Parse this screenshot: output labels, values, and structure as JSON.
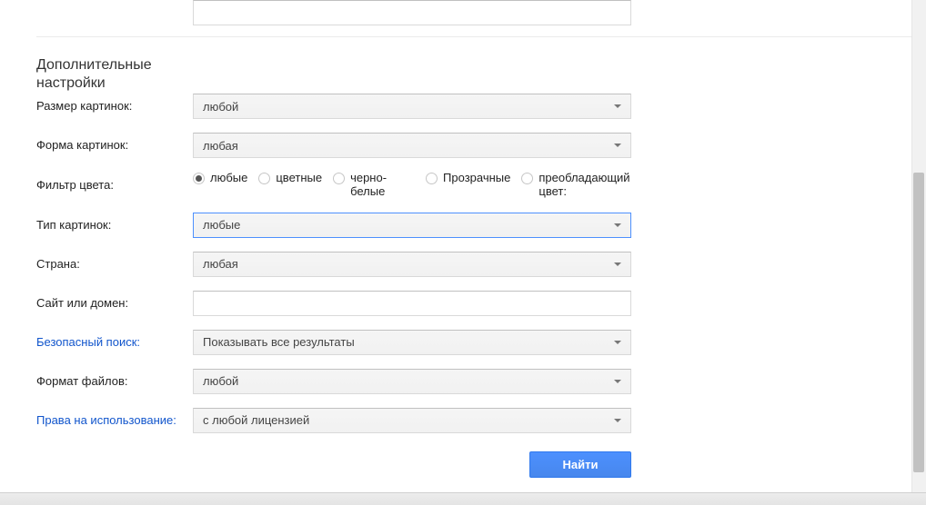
{
  "section_title_line1": "Дополнительные",
  "section_title_line2": "настройки",
  "rows": {
    "image_size": {
      "label": "Размер картинок:",
      "value": "любой"
    },
    "image_shape": {
      "label": "Форма картинок:",
      "value": "любая"
    },
    "color_filter": {
      "label": "Фильтр цвета:",
      "options": {
        "any": "любые",
        "color": "цветные",
        "bw": "черно-белые",
        "transp": "Прозрачные",
        "dominant": "преобладающий цвет:"
      },
      "selected": "any"
    },
    "image_type": {
      "label": "Тип картинок:",
      "value": "любые"
    },
    "country": {
      "label": "Страна:",
      "value": "любая"
    },
    "site": {
      "label": "Сайт или домен:",
      "value": ""
    },
    "safesearch": {
      "label": "Безопасный поиск:",
      "value": "Показывать все результаты"
    },
    "filetype": {
      "label": "Формат файлов:",
      "value": "любой"
    },
    "rights": {
      "label": "Права на использование:",
      "value": "с любой лицензией"
    }
  },
  "submit_label": "Найти"
}
